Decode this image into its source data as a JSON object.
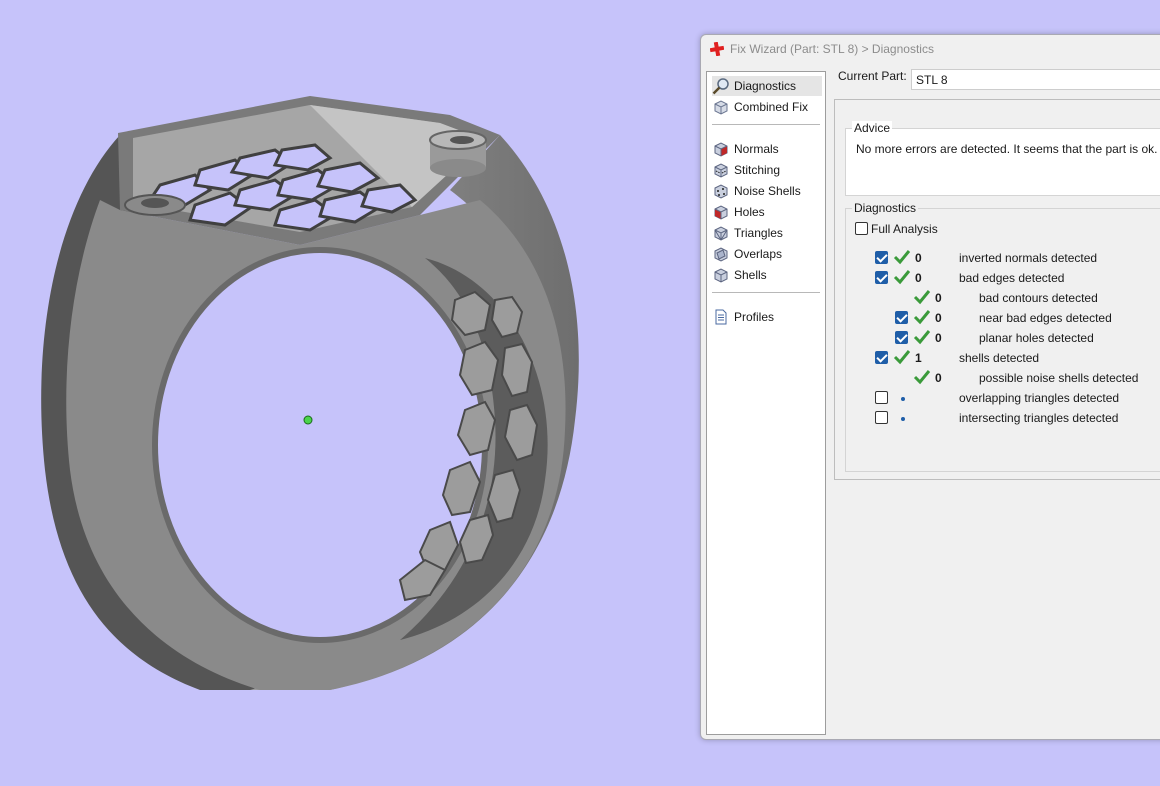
{
  "window": {
    "title": "Fix Wizard (Part: STL 8) > Diagnostics",
    "current_part_label": "Current Part:",
    "current_part_value": "STL 8"
  },
  "nav": {
    "items": [
      {
        "label": "Diagnostics",
        "icon": "magnifier-icon",
        "selected": true
      },
      {
        "label": "Combined Fix",
        "icon": "combined-fix-icon"
      },
      {
        "label": "Normals",
        "icon": "normals-cube-icon"
      },
      {
        "label": "Stitching",
        "icon": "stitching-cube-icon"
      },
      {
        "label": "Noise Shells",
        "icon": "noise-shells-cube-icon"
      },
      {
        "label": "Holes",
        "icon": "holes-cube-icon"
      },
      {
        "label": "Triangles",
        "icon": "triangles-cube-icon"
      },
      {
        "label": "Overlaps",
        "icon": "overlaps-cube-icon"
      },
      {
        "label": "Shells",
        "icon": "shells-cube-icon"
      },
      {
        "label": "Profiles",
        "icon": "document-icon"
      }
    ]
  },
  "advice": {
    "title": "Advice",
    "text": "No more errors are detected. It seems that the part is ok. Note"
  },
  "diagnostics": {
    "title": "Diagnostics",
    "full_analysis_label": "Full Analysis",
    "full_analysis_checked": false,
    "rows": [
      {
        "checkbox": true,
        "checked": true,
        "status": "ok",
        "count": "0",
        "label": "inverted normals detected"
      },
      {
        "checkbox": true,
        "checked": true,
        "status": "ok",
        "count": "0",
        "label": "bad edges detected"
      },
      {
        "checkbox": false,
        "status": "ok",
        "count": "0",
        "label": "bad contours detected"
      },
      {
        "checkbox": true,
        "checked": true,
        "status": "ok",
        "count": "0",
        "label": "near bad edges detected"
      },
      {
        "checkbox": true,
        "checked": true,
        "status": "ok",
        "count": "0",
        "label": "planar holes detected"
      },
      {
        "checkbox": true,
        "checked": true,
        "status": "ok",
        "count": "1",
        "label": "shells detected"
      },
      {
        "checkbox": false,
        "status": "ok",
        "count": "0",
        "label": "possible noise shells detected"
      },
      {
        "checkbox": true,
        "checked": false,
        "status": "pending",
        "count": "",
        "label": "overlapping triangles detected"
      },
      {
        "checkbox": true,
        "checked": false,
        "status": "pending",
        "count": "",
        "label": "intersecting triangles detected"
      }
    ]
  },
  "colors": {
    "viewport_background": "#c6c3fa",
    "check_green": "#3a9a3a",
    "checkbox_blue": "#1f5ea8",
    "wizard_red_cross": "#e02020"
  }
}
